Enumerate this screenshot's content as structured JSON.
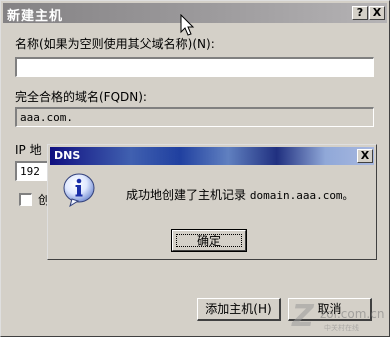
{
  "window": {
    "title": "新建主机",
    "help_glyph": "?",
    "close_glyph": "X"
  },
  "form": {
    "name_label": "名称(如果为空则使用其父域名称)(N):",
    "name_value": "",
    "fqdn_label": "完全合格的域名(FQDN):",
    "fqdn_value": "aaa.com.",
    "ip_label_partial": "IP 地",
    "ip_value_partial": "192",
    "checkbox_label_partial": "创"
  },
  "buttons": {
    "add_host": "添加主机(H)",
    "cancel": "取消"
  },
  "message_box": {
    "title": "DNS",
    "close_glyph": "X",
    "message_prefix": "成功地创建了主机记录",
    "message_domain": "domain.aaa.com。",
    "ok": "确定",
    "icon": "info-icon"
  },
  "watermark": {
    "text": "zol.com.cn",
    "subtext": "中关村在线"
  }
}
